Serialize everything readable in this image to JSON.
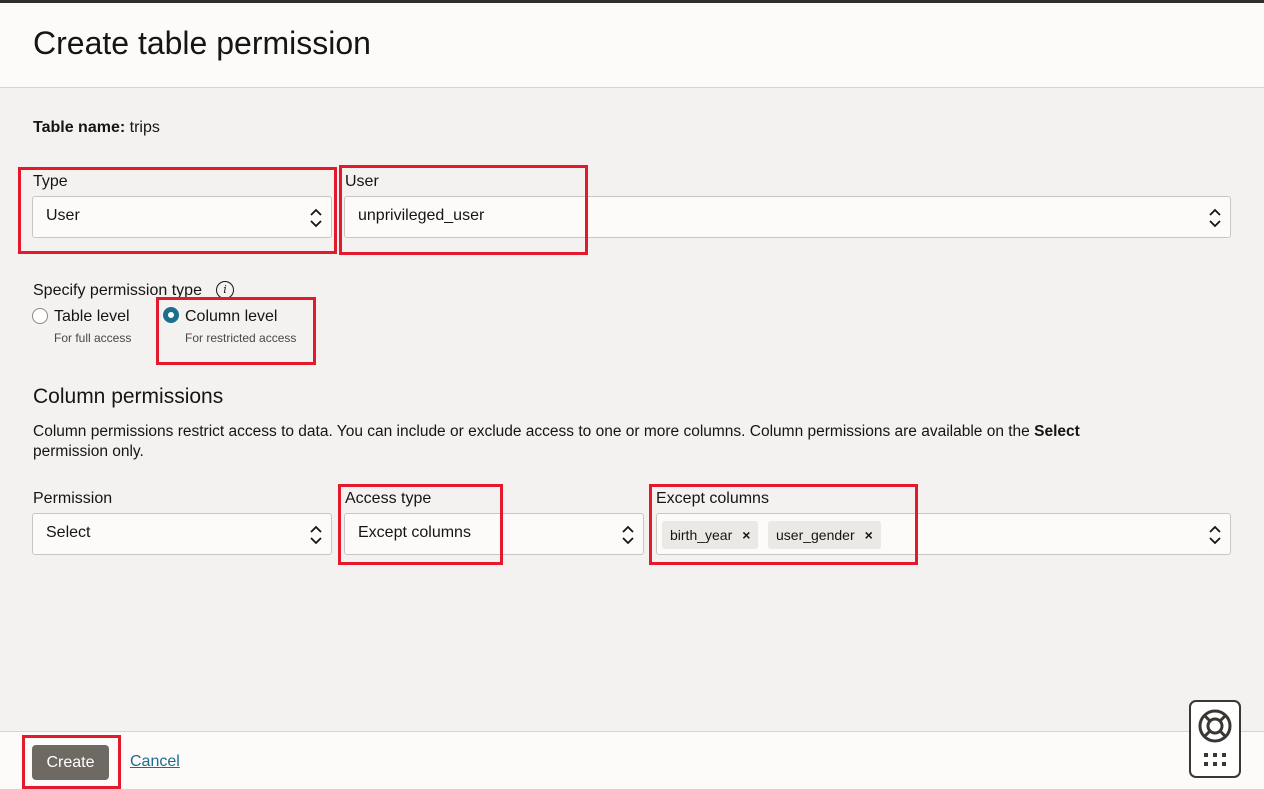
{
  "header": {
    "title": "Create table permission"
  },
  "table": {
    "label": "Table name:",
    "value": "trips"
  },
  "type_field": {
    "label": "Type",
    "value": "User"
  },
  "user_field": {
    "label": "User",
    "value": "unprivileged_user"
  },
  "permission_type": {
    "label": "Specify permission type",
    "options": [
      {
        "label": "Table level",
        "sub": "For full access",
        "selected": false
      },
      {
        "label": "Column level",
        "sub": "For restricted access",
        "selected": true
      }
    ]
  },
  "column_permissions": {
    "title": "Column permissions",
    "desc_pre": "Column permissions restrict access to data. You can include or exclude access to one or more columns. Column permissions are available on the ",
    "desc_bold": "Select",
    "desc_post": "permission only.",
    "permission": {
      "label": "Permission",
      "value": "Select"
    },
    "access_type": {
      "label": "Access type",
      "value": "Except columns"
    },
    "except_columns": {
      "label": "Except columns",
      "chips": [
        "birth_year",
        "user_gender"
      ],
      "remove_glyph": "×"
    }
  },
  "footer": {
    "create_label": "Create",
    "cancel_label": "Cancel"
  },
  "colors": {
    "accent": "#1c6e8f",
    "highlight": "#e21a2c",
    "button": "#6f6964"
  },
  "icons": [
    "info-icon",
    "chevron-updown-icon",
    "lifebuoy-icon",
    "grid-icon"
  ]
}
